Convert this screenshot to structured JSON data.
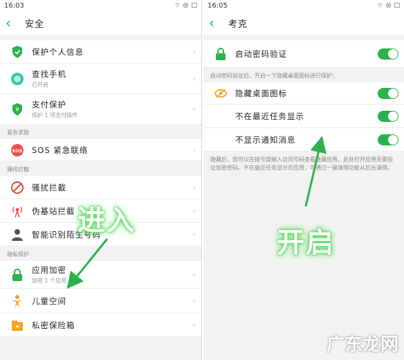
{
  "left": {
    "time": "16:03",
    "status_battery": "□",
    "title": "安全",
    "rows_top": [
      {
        "label": "保护个人信息",
        "sub": "",
        "icon": "shield-check-icon"
      },
      {
        "label": "查找手机",
        "sub": "已开启",
        "icon": "find-phone-icon"
      },
      {
        "label": "支付保护",
        "sub": "保护 1 项支付操作",
        "icon": "payment-shield-icon"
      }
    ],
    "section_emergency": "紧急求助",
    "sos_label": "SOS 紧急联络",
    "section_intercept": "骚扰拦截",
    "rows_intercept": [
      {
        "label": "骚扰拦截",
        "icon": "block-icon"
      },
      {
        "label": "伪基站拦截",
        "icon": "tower-icon"
      },
      {
        "label": "智能识别陌生号码",
        "icon": "person-icon"
      }
    ],
    "section_privacy": "隐私保护",
    "rows_privacy": [
      {
        "label": "应用加密",
        "sub": "加密 1 个应用",
        "icon": "lock-icon"
      },
      {
        "label": "儿童空间",
        "sub": "",
        "icon": "child-icon"
      },
      {
        "label": "私密保险箱",
        "sub": "",
        "icon": "safe-icon"
      }
    ],
    "overlay": "进入"
  },
  "right": {
    "time": "16:05",
    "title": "考克",
    "password_label": "启动密码验证",
    "section_hint": "启动密码验证后，开启一下隐藏桌面图标进行保护：",
    "hide_icon_label": "隐藏桌面图标",
    "not_in_recents_label": "不在最近任务显示",
    "no_notification_label": "不显示通知消息",
    "note": "隐藏后，您可以在拨号盘输入访问号码查看隐藏应用，此处打开应用无需验证加密密码。不在最近任务显示的应用，可通过一键清理功能从后台清理。",
    "overlay": "开启"
  },
  "watermark": "广东龙网",
  "colors": {
    "accent": "#2bb24c",
    "glow": "#57e05a"
  }
}
